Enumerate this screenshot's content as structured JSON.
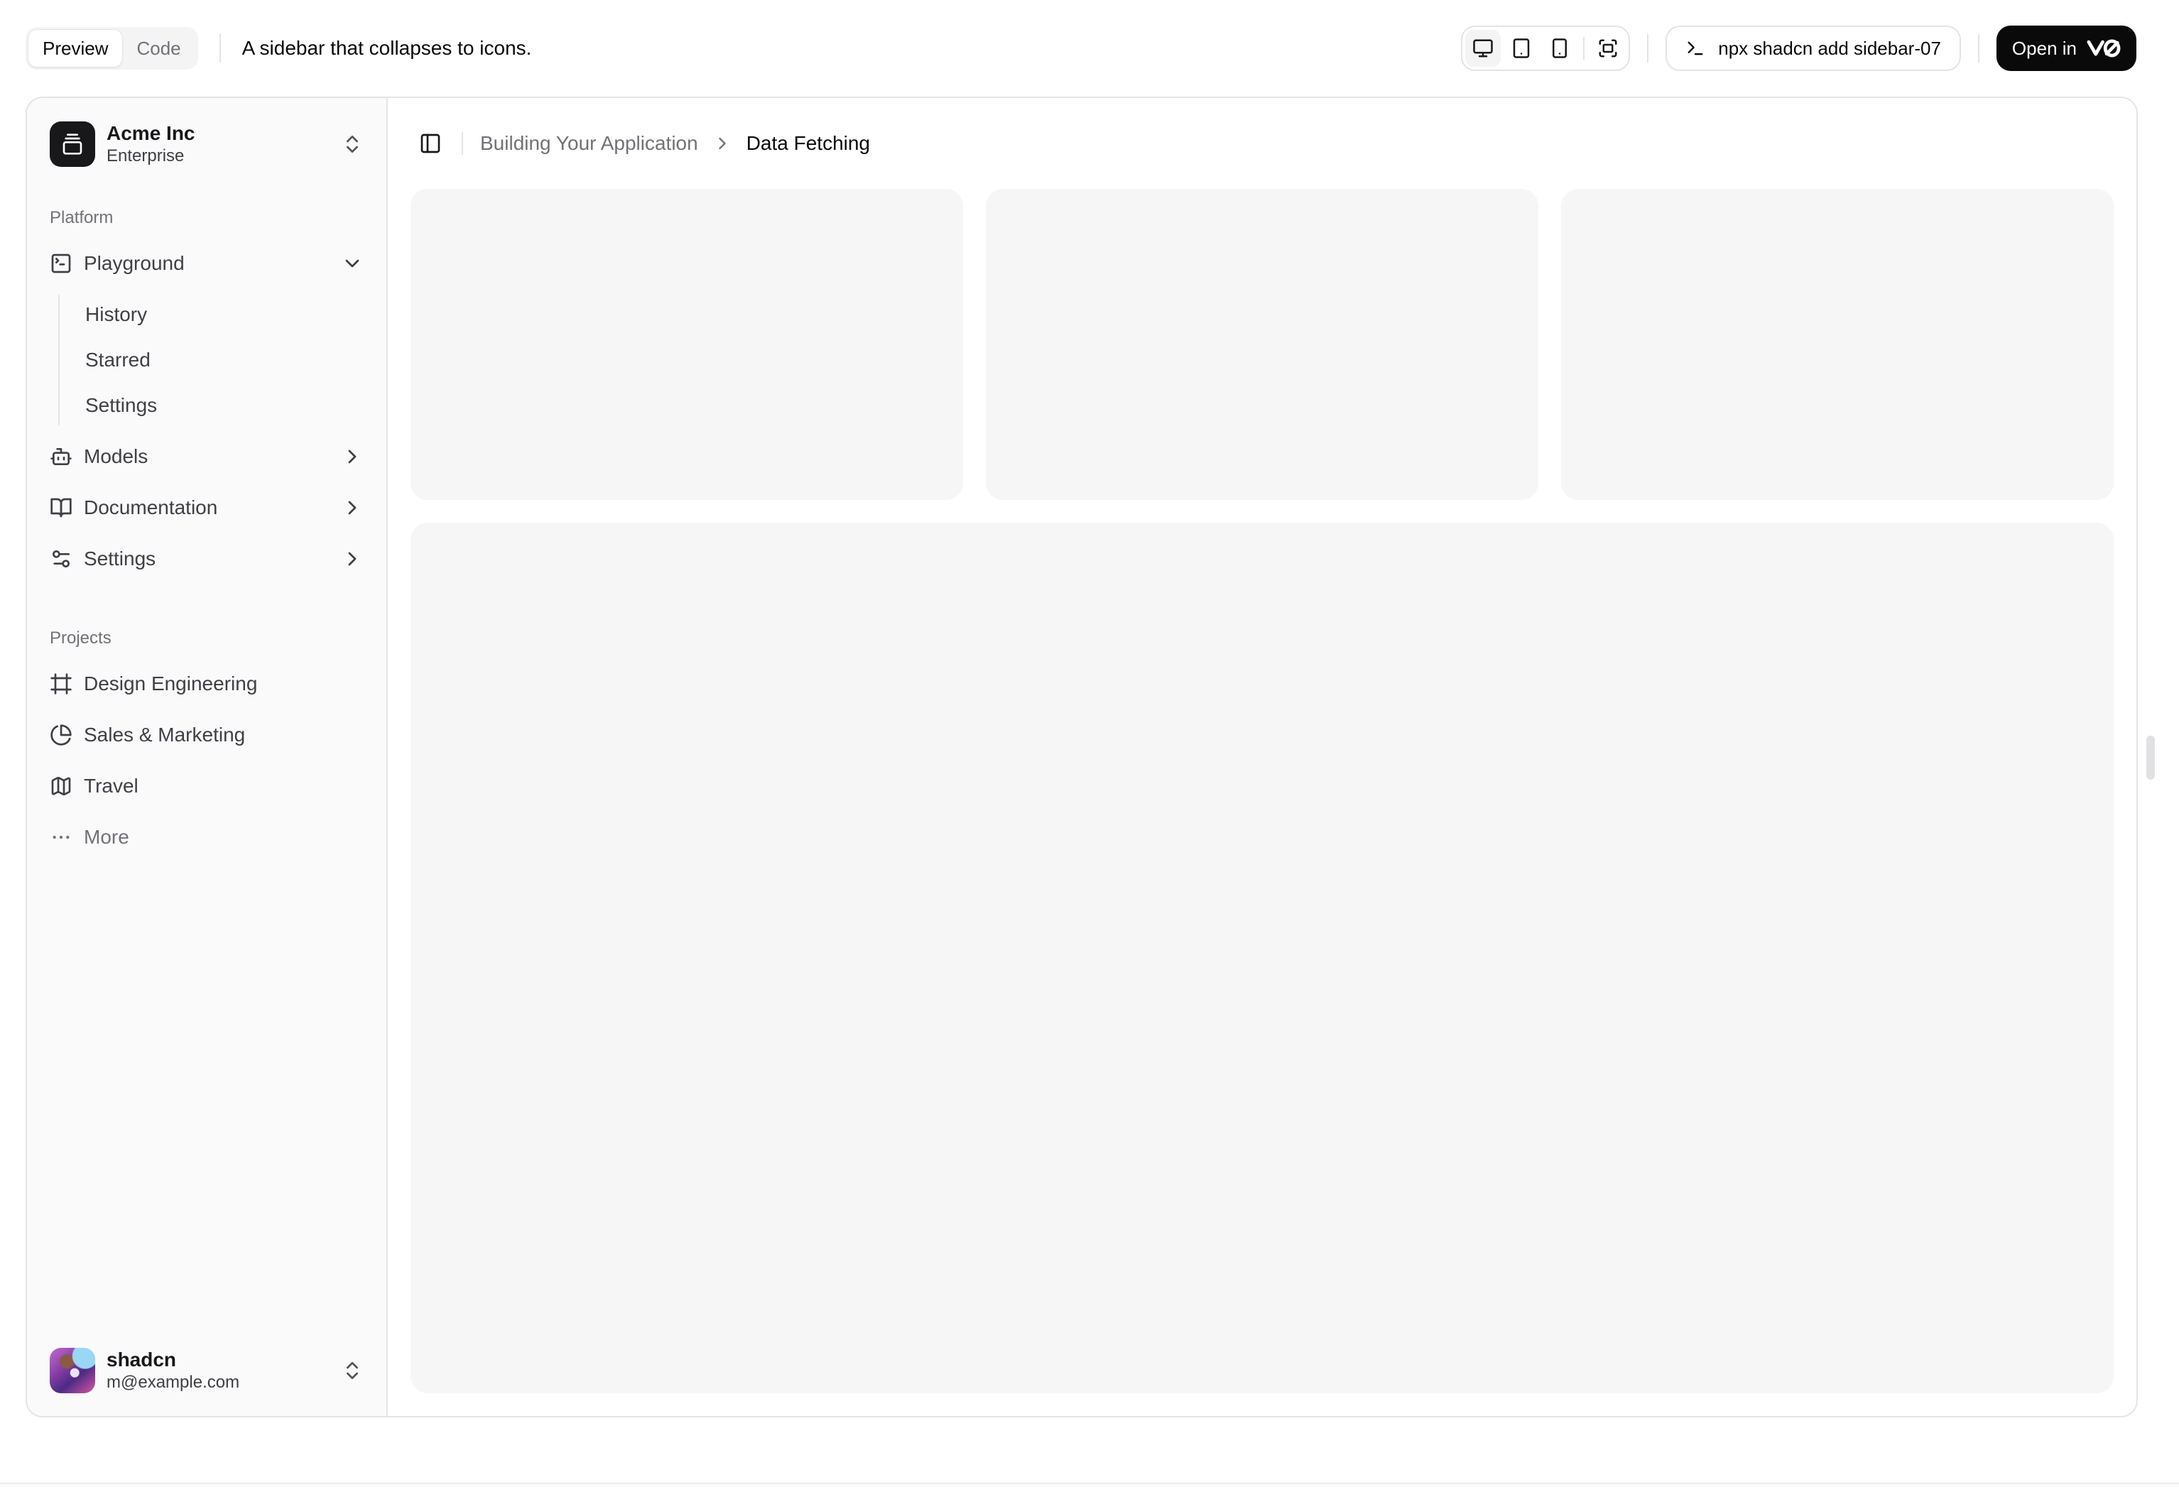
{
  "toolbar": {
    "tabs": {
      "preview": "Preview",
      "code": "Code"
    },
    "description": "A sidebar that collapses to icons.",
    "viewport_buttons": [
      {
        "name": "desktop-icon",
        "active": true
      },
      {
        "name": "tablet-icon",
        "active": false
      },
      {
        "name": "mobile-icon",
        "active": false
      },
      {
        "name": "fullscreen-icon",
        "active": false
      }
    ],
    "command": "npx shadcn add sidebar-07",
    "open_in_label": "Open in",
    "open_in_brand": "v0"
  },
  "sidebar": {
    "team": {
      "name": "Acme Inc",
      "plan": "Enterprise",
      "logo_icon": "gallery-vertical-end-icon"
    },
    "groups": [
      {
        "label": "Platform",
        "items": [
          {
            "label": "Playground",
            "icon": "square-terminal-icon",
            "expanded": true,
            "children": [
              {
                "label": "History"
              },
              {
                "label": "Starred"
              },
              {
                "label": "Settings"
              }
            ]
          },
          {
            "label": "Models",
            "icon": "bot-icon"
          },
          {
            "label": "Documentation",
            "icon": "book-open-icon"
          },
          {
            "label": "Settings",
            "icon": "settings-sliders-icon"
          }
        ]
      },
      {
        "label": "Projects",
        "items": [
          {
            "label": "Design Engineering",
            "icon": "frame-icon"
          },
          {
            "label": "Sales & Marketing",
            "icon": "pie-chart-icon"
          },
          {
            "label": "Travel",
            "icon": "map-icon"
          },
          {
            "label": "More",
            "icon": "ellipsis-icon"
          }
        ]
      }
    ],
    "user": {
      "name": "shadcn",
      "email": "m@example.com"
    }
  },
  "breadcrumb": {
    "parent": "Building Your Application",
    "current": "Data Fetching"
  },
  "colors": {
    "accent_text": "#09090b",
    "muted_text": "#71717a",
    "item_text": "#3f3f46",
    "border": "#e4e4e7",
    "sidebar_bg": "#fafafa",
    "placeholder_bg": "#f6f6f7",
    "primary_button_bg": "#0a0a0a",
    "logo_bg": "#18181b"
  }
}
